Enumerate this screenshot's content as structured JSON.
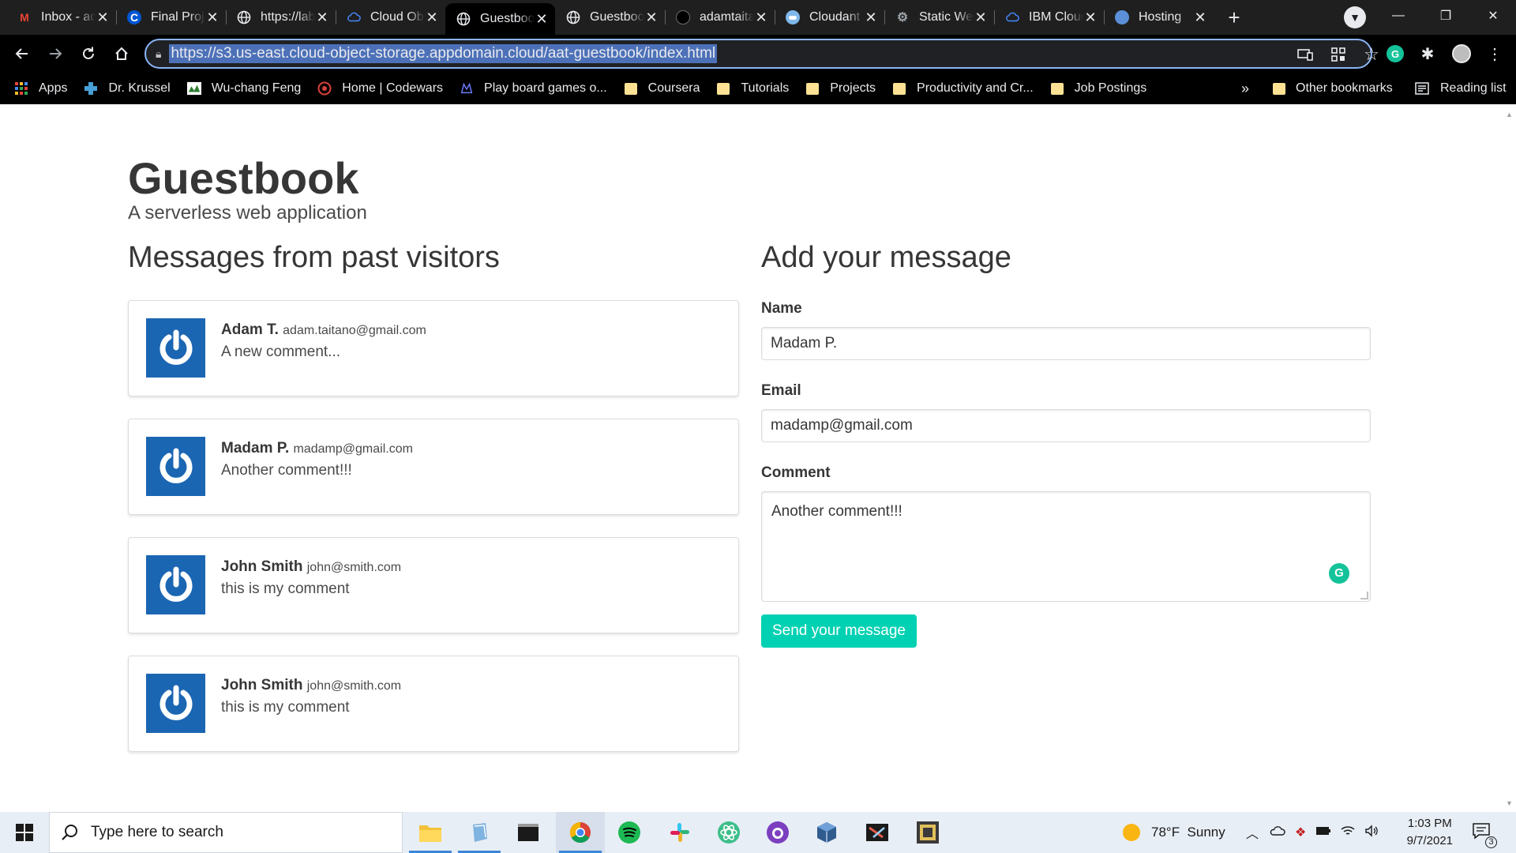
{
  "browser": {
    "tabs": [
      {
        "title": "Inbox - adam.taitano@gmail.com",
        "icon": "gmail-icon",
        "active": false
      },
      {
        "title": "Final Project",
        "icon": "coursera-icon",
        "active": false
      },
      {
        "title": "https://labs",
        "icon": "globe-icon",
        "active": false
      },
      {
        "title": "Cloud Object Storage",
        "icon": "ibm-cloud-icon",
        "active": false
      },
      {
        "title": "Guestbook",
        "icon": "globe-icon",
        "active": true
      },
      {
        "title": "Guestbook",
        "icon": "globe-icon",
        "active": false
      },
      {
        "title": "adamtaitano",
        "icon": "github-icon",
        "active": false
      },
      {
        "title": "Cloudant",
        "icon": "cloudant-icon",
        "active": false
      },
      {
        "title": "Static Website",
        "icon": "static-website-icon",
        "active": false
      },
      {
        "title": "IBM Cloud",
        "icon": "ibm-cloud-icon",
        "active": false
      },
      {
        "title": "Hosting",
        "icon": "hosting-icon",
        "active": false
      }
    ],
    "url": "https://s3.us-east.cloud-object-storage.appdomain.cloud/aat-guestbook/index.html",
    "bookmarks": [
      {
        "label": "Apps",
        "icon": "apps-grid-icon"
      },
      {
        "label": "Dr. Krussel",
        "icon": "cross-icon"
      },
      {
        "label": "Wu-chang Feng",
        "icon": "wu-chang-icon"
      },
      {
        "label": "Home | Codewars",
        "icon": "codewars-icon"
      },
      {
        "label": "Play board games o...",
        "icon": "boardgames-icon"
      },
      {
        "label": "Coursera",
        "icon": "folder-icon"
      },
      {
        "label": "Tutorials",
        "icon": "folder-icon"
      },
      {
        "label": "Projects",
        "icon": "folder-icon"
      },
      {
        "label": "Productivity and Cr...",
        "icon": "folder-icon"
      },
      {
        "label": "Job Postings",
        "icon": "folder-icon"
      }
    ],
    "overflow_label": "»",
    "other_bookmarks": "Other bookmarks",
    "reading_list": "Reading list"
  },
  "page": {
    "title": "Guestbook",
    "subtitle": "A serverless web application",
    "messages_heading": "Messages from past visitors",
    "messages": [
      {
        "name": "Adam T.",
        "email": "adam.taitano@gmail.com",
        "comment": "A new comment..."
      },
      {
        "name": "Madam P.",
        "email": "madamp@gmail.com",
        "comment": "Another comment!!!"
      },
      {
        "name": "John Smith",
        "email": "john@smith.com",
        "comment": "this is my comment"
      },
      {
        "name": "John Smith",
        "email": "john@smith.com",
        "comment": "this is my comment"
      }
    ],
    "form": {
      "heading": "Add your message",
      "name_label": "Name",
      "name_value": "Madam P.",
      "email_label": "Email",
      "email_value": "madamp@gmail.com",
      "comment_label": "Comment",
      "comment_value": "Another comment!!!",
      "submit_label": "Send your message"
    }
  },
  "taskbar": {
    "search_placeholder": "Type here to search",
    "weather": "78°F  Sunny",
    "time": "1:03 PM",
    "date": "9/7/2021",
    "notifications": "3"
  },
  "colors": {
    "accent": "#00d1b2",
    "avatar": "#1b66b3",
    "omnibox_border": "#8ab4f8"
  }
}
